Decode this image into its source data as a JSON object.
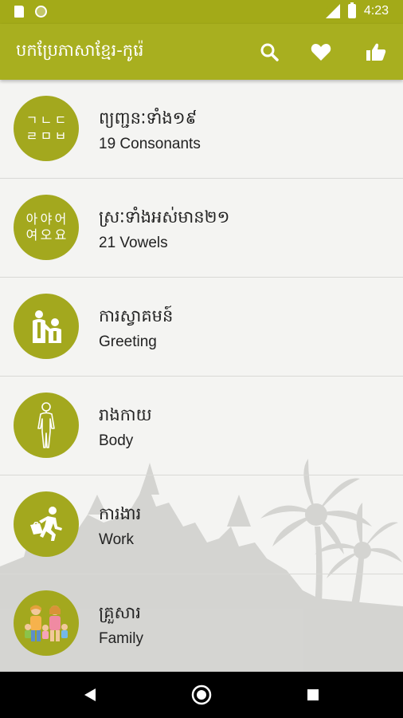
{
  "status_bar": {
    "network": "LTE",
    "time": "4:23"
  },
  "app_bar": {
    "title": "បកប្រែភាសាខ្មែរ-កូរ៉េ",
    "icons": [
      "search-icon",
      "heart-icon",
      "thumbs-up-icon"
    ]
  },
  "categories": [
    {
      "title": "ព្យញ្ជនៈទាំង១៩",
      "subtitle": "19 Consonants",
      "icon": "consonants-icon",
      "glyphs": [
        "ㄱ",
        "ㄴ",
        "ㄷ",
        "ㄹ",
        "ㅁ",
        "ㅂ"
      ]
    },
    {
      "title": "ស្រៈទាំងអស់មាន២១",
      "subtitle": "21 Vowels",
      "icon": "vowels-icon",
      "glyphs": [
        "아",
        "야",
        "어",
        "여",
        "오",
        "요"
      ]
    },
    {
      "title": "ការស្វាគមន៍",
      "subtitle": "Greeting",
      "icon": "greeting-icon"
    },
    {
      "title": "រាងកាយ",
      "subtitle": "Body",
      "icon": "body-icon"
    },
    {
      "title": "ការងារ",
      "subtitle": "Work",
      "icon": "work-icon"
    },
    {
      "title": "គ្រួសារ",
      "subtitle": "Family",
      "icon": "family-icon"
    }
  ],
  "colors": {
    "app_bar": "#a8af1f",
    "status_bar": "#a3aa18",
    "icon_circle": "#a3a81e"
  }
}
